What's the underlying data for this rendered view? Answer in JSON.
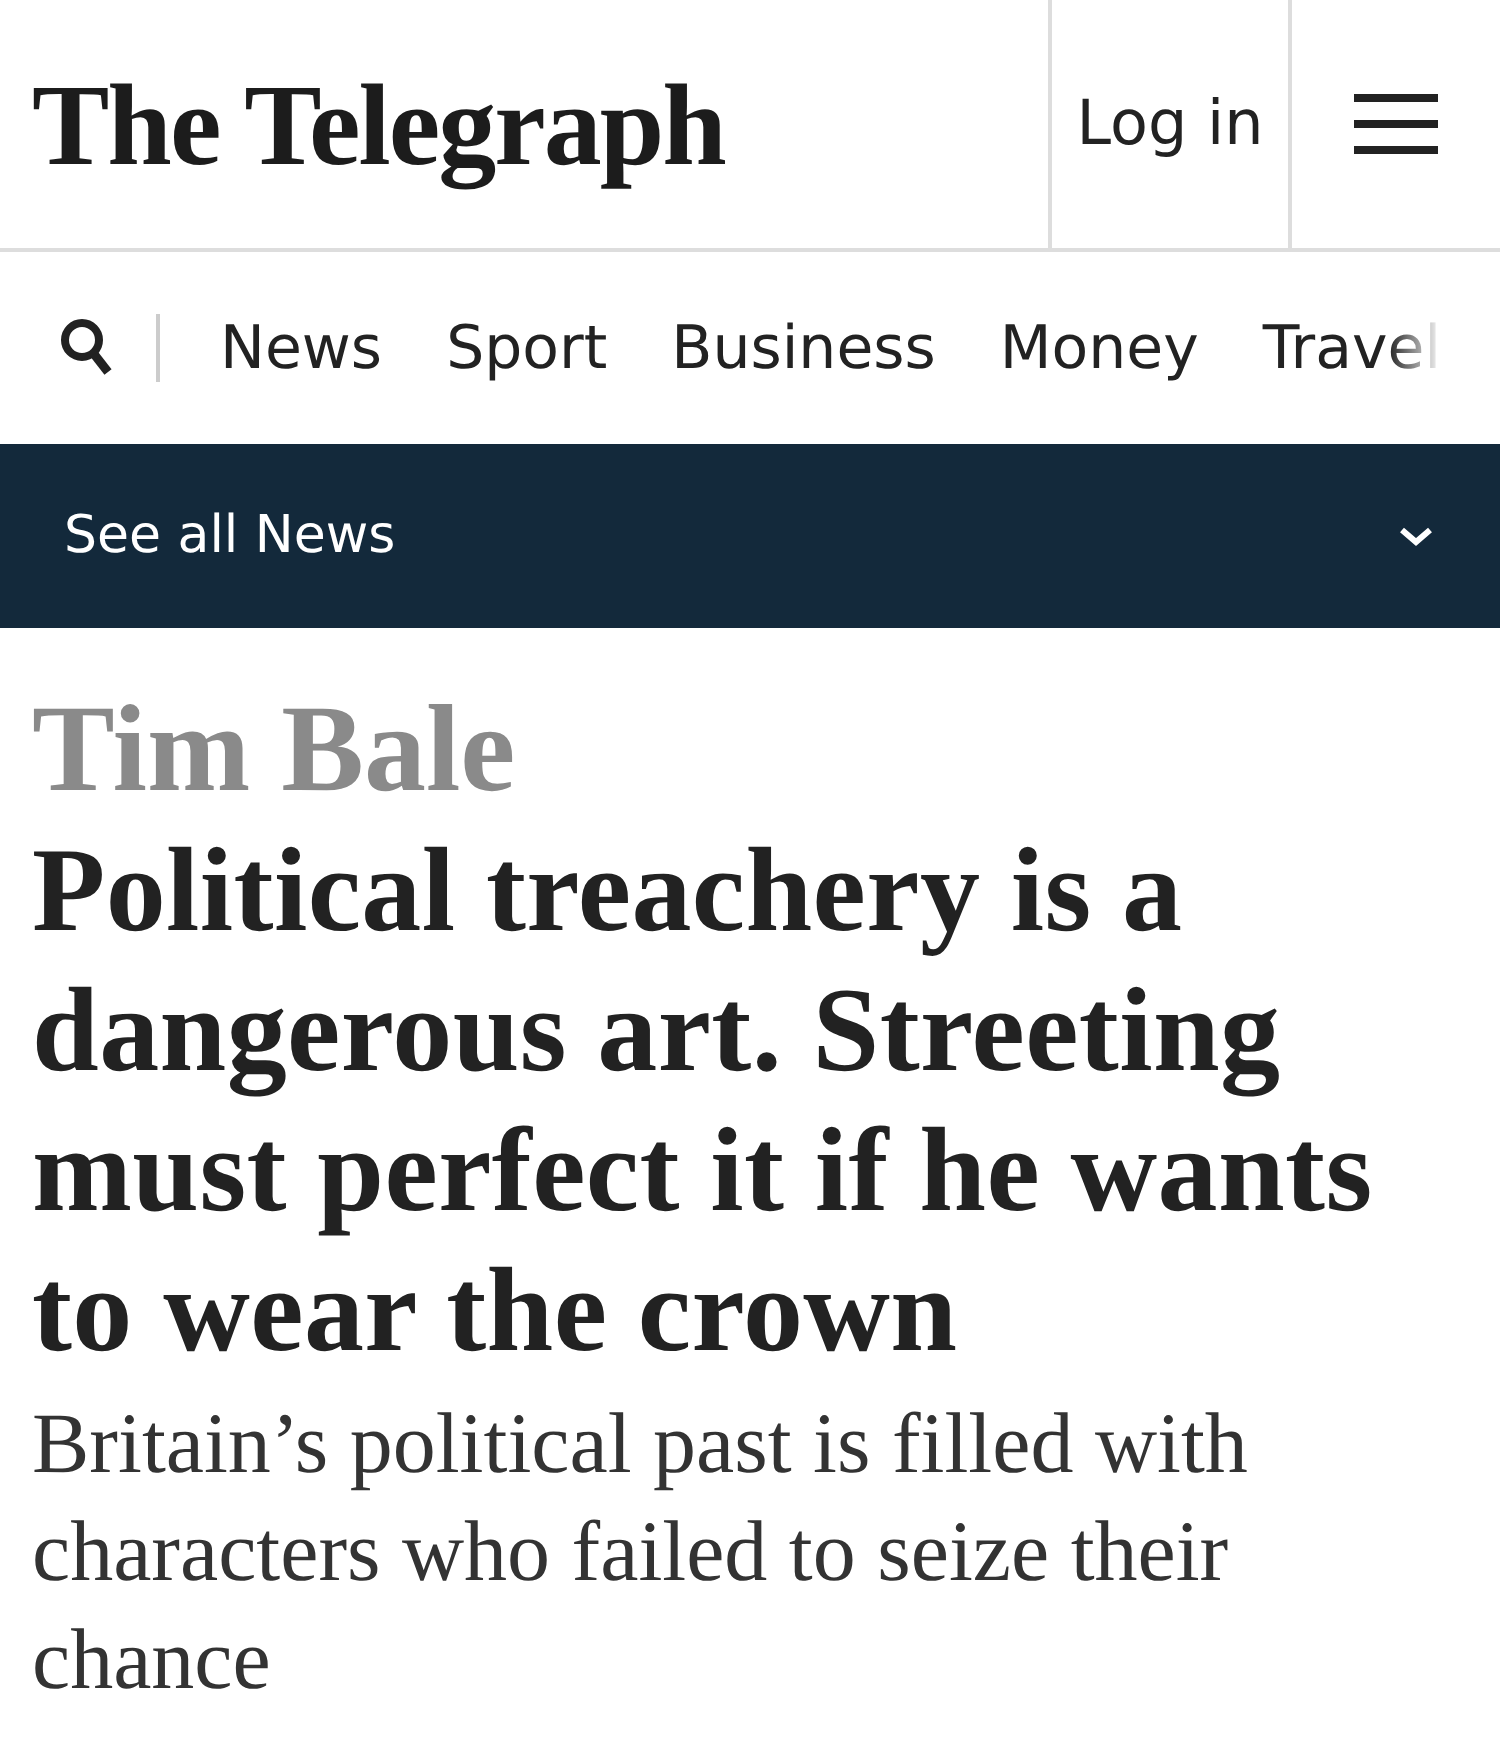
{
  "header": {
    "logo": "The Telegraph",
    "login": "Log in"
  },
  "nav": {
    "items": [
      "News",
      "Sport",
      "Business",
      "Money",
      "Travel"
    ]
  },
  "section_bar": {
    "label": "See all News",
    "expanded": false
  },
  "article": {
    "author": "Tim Bale",
    "headline": "Political treachery is a dangerous art. Streeting must perfect it if he wants to wear the crown",
    "standfirst": "Britain’s political past is filled with characters who failed to seize their chance"
  }
}
